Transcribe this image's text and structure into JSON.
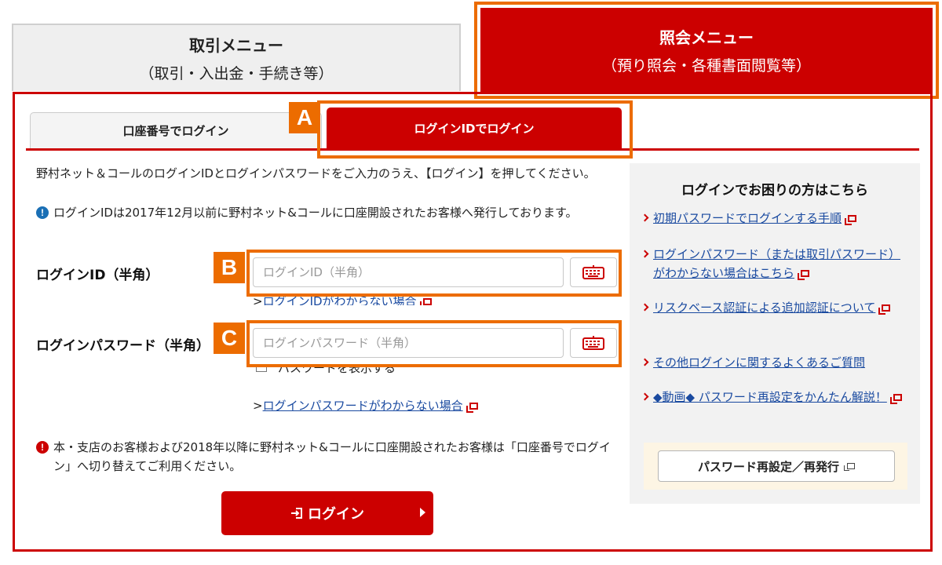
{
  "menus": {
    "trade": {
      "title": "取引メニュー",
      "subtitle": "（取引・入出金・手続き等）"
    },
    "inquiry": {
      "title": "照会メニュー",
      "subtitle": "（預り照会・各種書面閲覧等）"
    }
  },
  "tabs": {
    "account_login": "口座番号でログイン",
    "id_login": "ログインIDでログイン"
  },
  "badges": {
    "a": "A",
    "b": "B",
    "c": "C"
  },
  "intro_text": "野村ネット＆コールのログインIDとログインパスワードをご入力のうえ、【ログイン】を押してください。",
  "notice_text": "ログインIDは2017年12月以前に野村ネット&コールに口座開設されたお客様へ発行しております。",
  "login_id": {
    "label": "ログインID（半角）",
    "placeholder": "ログインID（半角）",
    "value": "",
    "forgot_prefix": ">",
    "forgot_link": "ログインIDがわからない場合"
  },
  "password": {
    "label": "ログインパスワード（半角）",
    "placeholder": "ログインパスワード（半角）",
    "value": "",
    "show_label": "パスワードを表示する",
    "forgot_prefix": ">",
    "forgot_link": "ログインパスワードがわからない場合"
  },
  "warning_text": "本・支店のお客様および2018年以降に野村ネット&コールに口座開設されたお客様は「口座番号でログイン」へ切り替えてご利用ください。",
  "login_button": "ログイン",
  "help": {
    "title": "ログインでお困りの方はこちら",
    "items": [
      {
        "label": "初期パスワードでログインする手順"
      },
      {
        "label": "ログインパスワード（または取引パスワード）がわからない場合はこちら"
      },
      {
        "label": "リスクベース認証による追加認証について"
      },
      {
        "label": "その他ログインに関するよくあるご質問"
      },
      {
        "label": "◆動画◆ パスワード再設定をかんたん解説！"
      }
    ],
    "reset_button": "パスワード再設定／再発行"
  },
  "colors": {
    "brand_red": "#cc0000",
    "highlight_orange": "#ec6c00",
    "link_blue": "#1a4aa0"
  }
}
